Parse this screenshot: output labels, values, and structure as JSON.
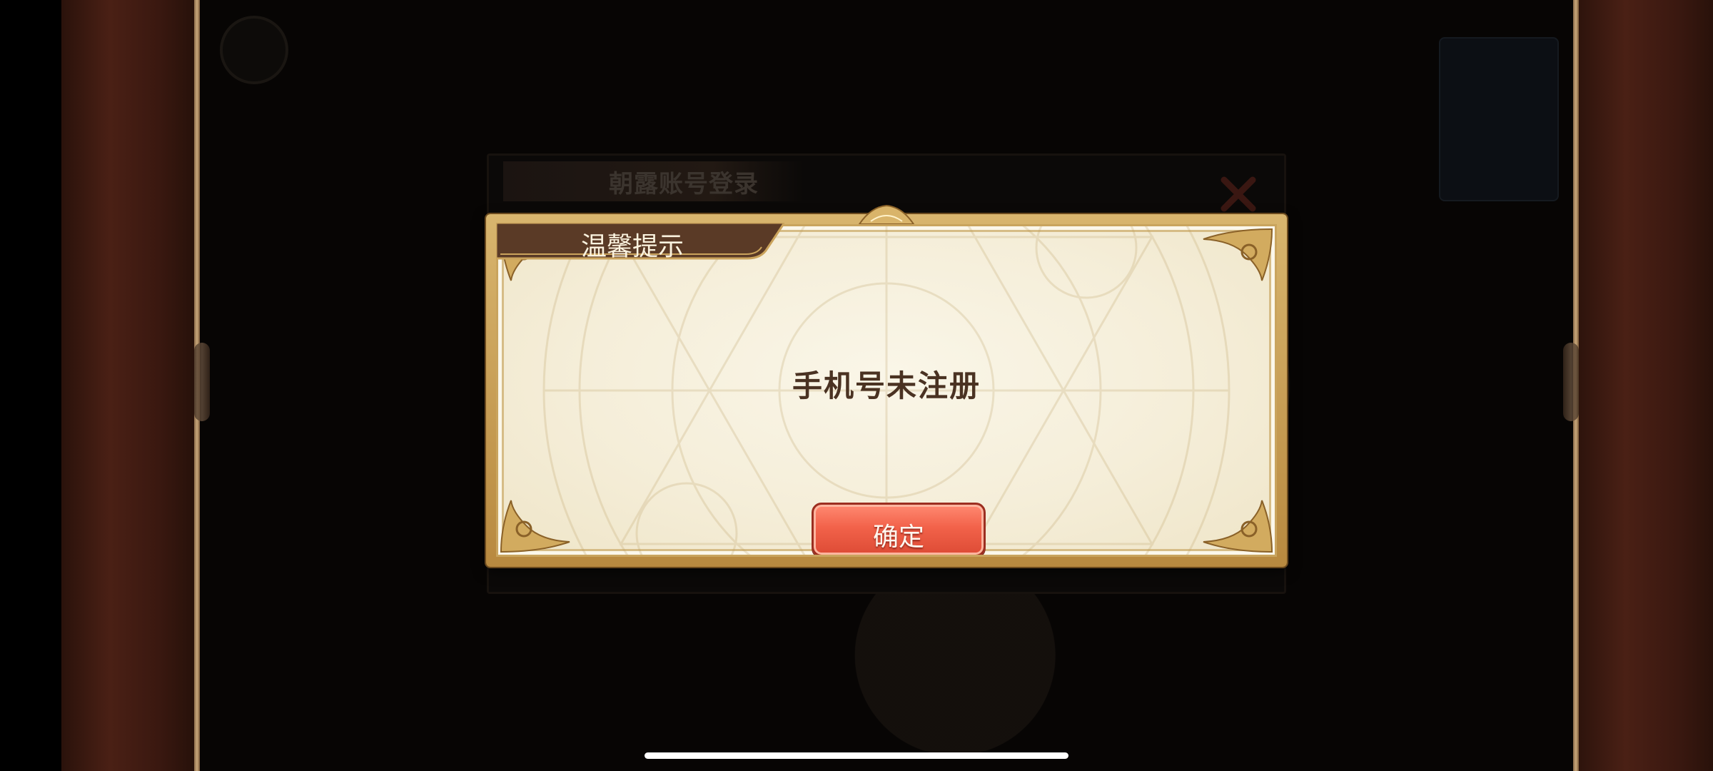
{
  "background": {
    "login_dialog_title": "朝露账号登录"
  },
  "notice": {
    "title": "温馨提示",
    "message": "手机号未注册",
    "confirm_label": "确定"
  },
  "colors": {
    "dialog_frame": "#c9a45e",
    "parchment": "#f5eed9",
    "ribbon": "#5a3a26",
    "confirm_button": "#f2624a",
    "message_text": "#4a3222"
  },
  "icons": {
    "login_close": "close-x-icon",
    "ornaments": "gold-scroll-corner"
  }
}
